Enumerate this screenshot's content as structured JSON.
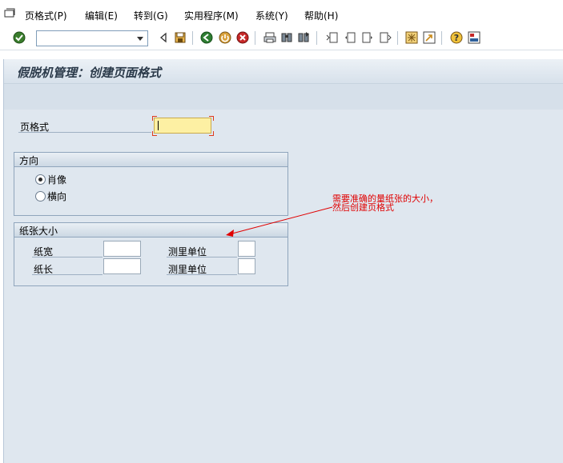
{
  "menu": {
    "items": [
      {
        "label": "页格式(P)"
      },
      {
        "label": "编辑(E)"
      },
      {
        "label": "转到(G)"
      },
      {
        "label": "实用程序(M)"
      },
      {
        "label": "系统(Y)"
      },
      {
        "label": "帮助(H)"
      }
    ]
  },
  "toolbar": {
    "command_field_value": "",
    "icons": [
      "enter-check-icon",
      "command-dropdown-icon",
      "back-arrow-small-icon",
      "save-icon",
      "back-icon",
      "exit-icon",
      "cancel-icon",
      "print-icon",
      "find-icon",
      "find-next-icon",
      "first-page-icon",
      "previous-page-icon",
      "next-page-icon",
      "last-page-icon",
      "create-session-icon",
      "shortcut-icon",
      "help-icon",
      "customize-layout-icon"
    ]
  },
  "window": {
    "title": "假脱机管理：创建页面格式"
  },
  "form": {
    "page_format_label": "页格式",
    "page_format_value": "",
    "orientation": {
      "title": "方向",
      "options": [
        {
          "label": "肖像",
          "selected": true
        },
        {
          "label": "横向",
          "selected": false
        }
      ]
    },
    "paper_size": {
      "title": "纸张大小",
      "width_label": "纸宽",
      "width_value": "",
      "width_unit_label": "测里单位",
      "width_unit_value": "",
      "length_label": "纸长",
      "length_value": "",
      "length_unit_label": "测里单位",
      "length_unit_value": ""
    }
  },
  "annotation": {
    "line1": "需要准确的量纸张的大小，",
    "line2": "然后创建页格式",
    "color": "#e00000"
  },
  "colors": {
    "background": "#dfe7ef",
    "required_field": "#fdf0a3",
    "annotation_arrow": "#e00000"
  }
}
